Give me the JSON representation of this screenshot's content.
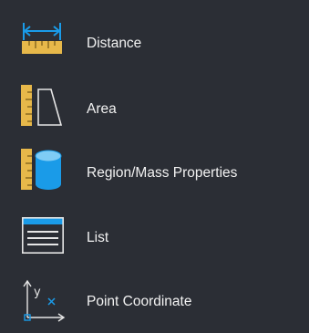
{
  "menu": {
    "items": [
      {
        "label": "Distance",
        "icon": "measure-distance-icon"
      },
      {
        "label": "Area",
        "icon": "measure-area-icon"
      },
      {
        "label": "Region/Mass Properties",
        "icon": "region-mass-properties-icon"
      },
      {
        "label": "List",
        "icon": "list-icon"
      },
      {
        "label": "Point Coordinate",
        "icon": "point-coordinate-icon"
      }
    ]
  },
  "colors": {
    "background": "#2b2e35",
    "text": "#f2f2f2",
    "ruler": "#e7b84a",
    "accent_blue": "#1a9be8",
    "icon_outline": "#e6e6e6"
  }
}
